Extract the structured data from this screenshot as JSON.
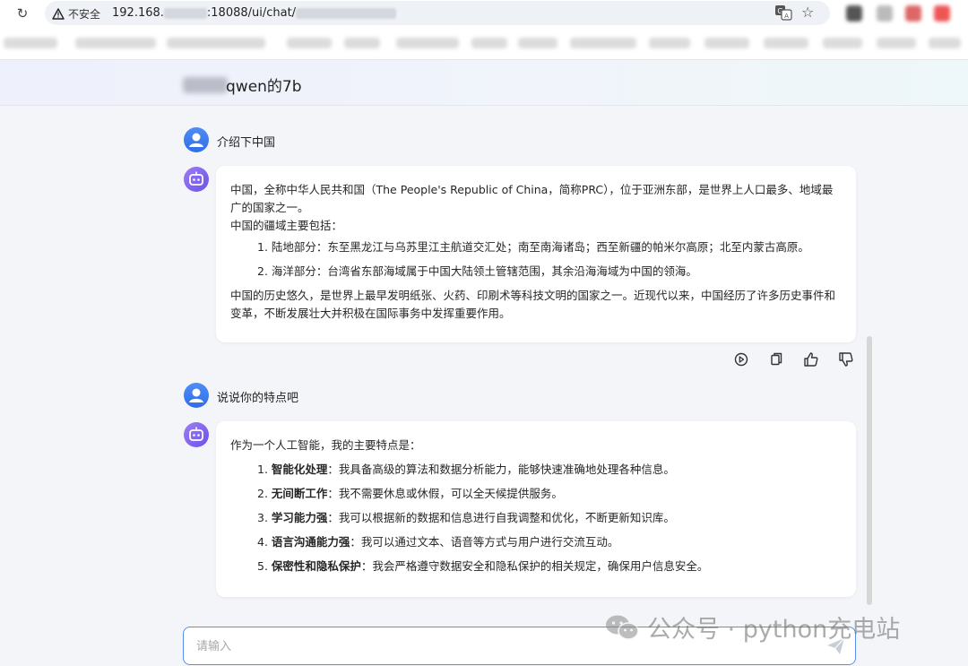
{
  "browser": {
    "security_label": "不安全",
    "url_prefix": "192.168.",
    "url_port_path": ":18088/ui/chat/"
  },
  "chat": {
    "title": "qwen的7b",
    "input_placeholder": "请输入"
  },
  "messages": [
    {
      "role": "user",
      "text": "介绍下中国"
    },
    {
      "role": "assistant",
      "intro_1": "中国，全称中华人民共和国（The People's Republic of China，简称PRC），位于亚洲东部，是世界上人口最多、地域最广的国家之一。",
      "intro_2": "中国的疆域主要包括：",
      "items": [
        "1. 陆地部分：东至黑龙江与乌苏里江主航道交汇处；南至南海诸岛；西至新疆的帕米尔高原；北至内蒙古高原。",
        "2. 海洋部分：台湾省东部海域属于中国大陆领土管辖范围，其余沿海海域为中国的领海。"
      ],
      "outro": "中国的历史悠久，是世界上最早发明纸张、火药、印刷术等科技文明的国家之一。近现代以来，中国经历了许多历史事件和变革，不断发展壮大并积极在国际事务中发挥重要作用。"
    },
    {
      "role": "user",
      "text": "说说你的特点吧"
    },
    {
      "role": "assistant",
      "intro_1": "作为一个人工智能，我的主要特点是：",
      "items": [
        {
          "num": "1. ",
          "bold": "智能化处理",
          "rest": "：我具备高级的算法和数据分析能力，能够快速准确地处理各种信息。"
        },
        {
          "num": "2. ",
          "bold": "无间断工作",
          "rest": "：我不需要休息或休假，可以全天候提供服务。"
        },
        {
          "num": "3. ",
          "bold": "学习能力强",
          "rest": "：我可以根据新的数据和信息进行自我调整和优化，不断更新知识库。"
        },
        {
          "num": "4. ",
          "bold": "语言沟通能力强",
          "rest": "：我可以通过文本、语音等方式与用户进行交流互动。"
        },
        {
          "num": "5. ",
          "bold": "保密性和隐私保护",
          "rest": "：我会严格遵守数据安全和隐私保护的相关规定，确保用户信息安全。"
        }
      ]
    }
  ],
  "watermark": {
    "text": "公众号 · python充电站"
  },
  "colors": {
    "accent": "#5a8dee",
    "user_avatar": "#3b7cf0",
    "bot_avatar": "#7b5ff0"
  }
}
